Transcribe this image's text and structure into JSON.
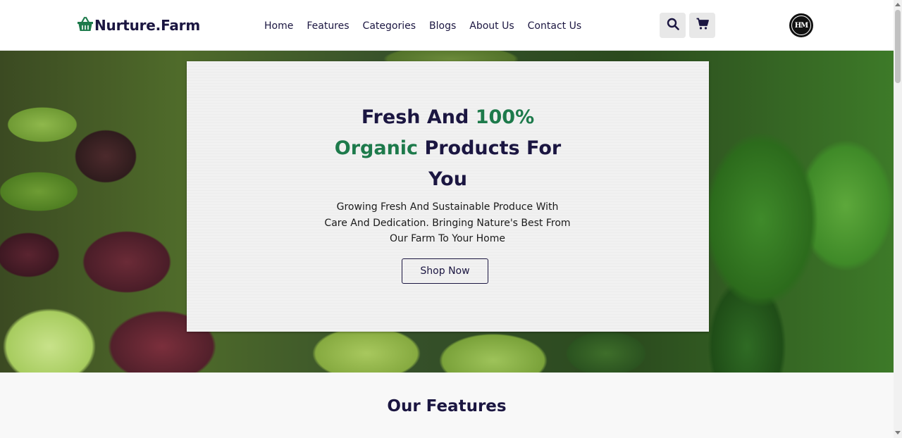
{
  "header": {
    "logo_text": "Nurture.Farm",
    "logo_icon": "basket-icon",
    "nav": [
      {
        "label": "Home"
      },
      {
        "label": "Features"
      },
      {
        "label": "Categories"
      },
      {
        "label": "Blogs"
      },
      {
        "label": "About Us"
      },
      {
        "label": "Contact Us"
      }
    ],
    "search_icon": "search-icon",
    "cart_icon": "cart-icon",
    "avatar_initials": "HM"
  },
  "hero": {
    "title_parts": {
      "line1_a": "Fresh And ",
      "line1_b": "100%",
      "line2_a": "Organic",
      "line2_b": " Products For",
      "line3": "You"
    },
    "subtitle": "Growing Fresh And Sustainable Produce With Care And Dedication. Bringing Nature's Best From Our Farm To Your Home",
    "cta_label": "Shop Now"
  },
  "features": {
    "title": "Our Features"
  },
  "colors": {
    "brand_dark": "#1b1641",
    "accent_green": "#1d7a4b",
    "header_bg": "#ffffff",
    "card_bg": "#f1f1f1"
  }
}
